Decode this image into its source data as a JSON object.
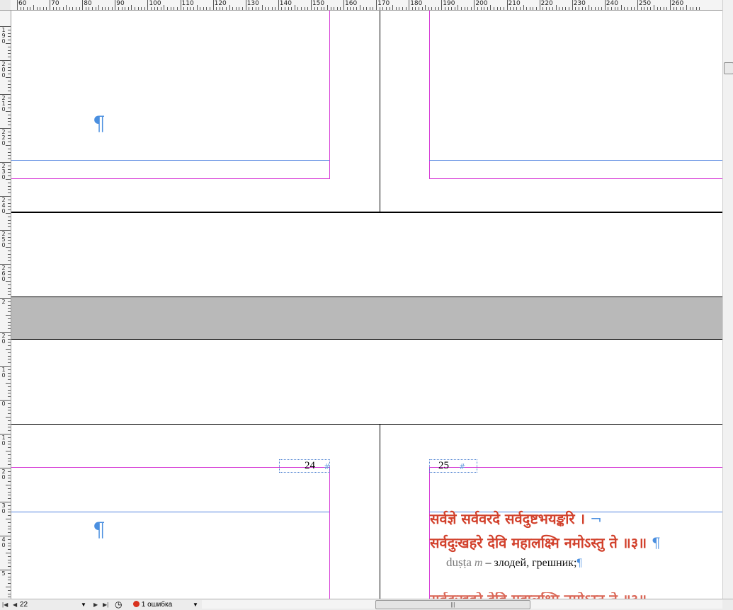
{
  "ruler": {
    "top_labels": [
      "60",
      "70",
      "80",
      "90",
      "100",
      "110",
      "120",
      "130",
      "140",
      "150",
      "160",
      "170",
      "180",
      "190",
      "200",
      "210",
      "220",
      "230",
      "240",
      "250",
      "260"
    ],
    "left_labels": [
      "190",
      "200",
      "210",
      "220",
      "230",
      "240",
      "250",
      "260",
      "2",
      "20",
      "10",
      "0",
      "10",
      "20",
      "30",
      "40",
      "5"
    ]
  },
  "pages": {
    "left_number": "24",
    "right_number": "25",
    "hash_symbol": "#"
  },
  "text": {
    "pilcrow": "¶",
    "sanskrit_line1": "सर्वज्ञे सर्ववरदे सर्वदुष्टभयङ्करि ।",
    "sanskrit_line1_end": "¬",
    "sanskrit_line2": "सर्वदुःखहरे देवि महालक्ष्मि नमोऽस्तु ते ॥३॥",
    "sanskrit_line2_end": "¶",
    "gloss_term": "duṣṭa",
    "gloss_gender": "m",
    "gloss_def": "– злодей, грешник;",
    "gloss_end": "¶"
  },
  "statusbar": {
    "page_value": "22",
    "error_text": "1 ошибка",
    "first_btn": "|◀",
    "prev_btn": "◀",
    "next_btn": "▶",
    "last_btn": "▶|",
    "dropdown_arrow": "▼",
    "hscroll_grip": "|||"
  },
  "colors": {
    "margin_guide": "#d63ad6",
    "column_guide": "#4f82e0",
    "page_edge": "#000000",
    "sanskrit_text": "#d2412c",
    "pasteboard": "#b9b9b9"
  },
  "icons": {
    "error": "red-dot-icon",
    "preflight": "preflight-icon",
    "dropdown": "chevron-down-icon"
  }
}
